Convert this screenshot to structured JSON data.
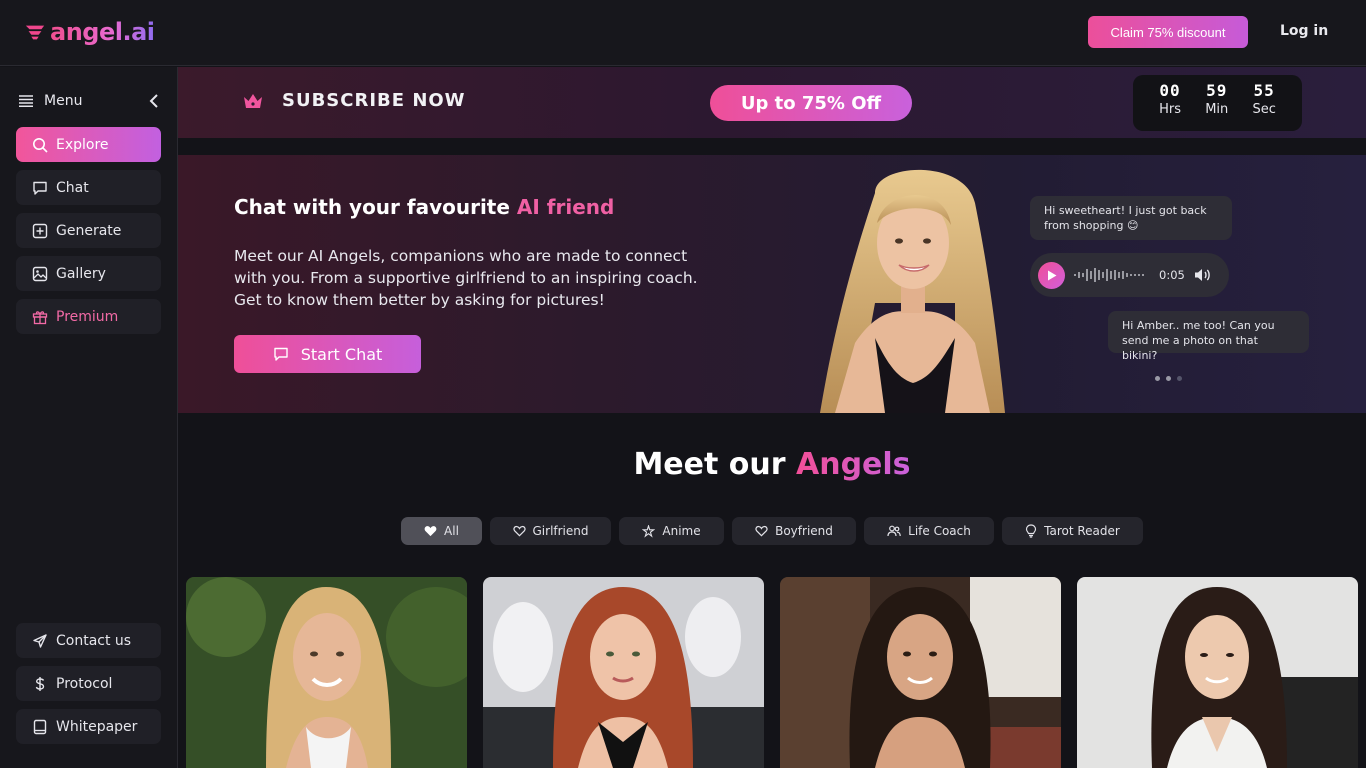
{
  "app": {
    "logo_text": "angel.ai"
  },
  "topbar": {
    "claim_label": "Claim 75% discount",
    "login_label": "Log in"
  },
  "sidebar": {
    "menu_label": "Menu",
    "items": [
      {
        "label": "Explore",
        "icon": "search-icon"
      },
      {
        "label": "Chat",
        "icon": "chat-icon"
      },
      {
        "label": "Generate",
        "icon": "plus-square-icon"
      },
      {
        "label": "Gallery",
        "icon": "image-icon"
      },
      {
        "label": "Premium",
        "icon": "gift-icon"
      }
    ],
    "bottom_items": [
      {
        "label": "Contact us",
        "icon": "send-icon"
      },
      {
        "label": "Protocol",
        "icon": "dollar-icon"
      },
      {
        "label": "Whitepaper",
        "icon": "book-icon"
      }
    ]
  },
  "subscribe": {
    "title": "SUBSCRIBE NOW",
    "offer_label": "Up to 75% Off",
    "timer": {
      "hrs": "00",
      "min": "59",
      "sec": "55",
      "hrs_label": "Hrs",
      "min_label": "Min",
      "sec_label": "Sec"
    }
  },
  "hero": {
    "title_prefix": "Chat with your favourite ",
    "title_accent": "AI friend",
    "description": "Meet our AI Angels, companions who are made to connect with you. From a supportive girlfriend to an inspiring coach. Get to know them better by asking for pictures!",
    "start_label": "Start Chat",
    "bubble_1": "Hi sweetheart! I just got back from shopping 😊",
    "audio_time": "0:05",
    "bubble_2": "Hi Amber.. me too! Can you send me a photo on that bikini?"
  },
  "meet": {
    "title_prefix": "Meet our ",
    "title_accent": "Angels",
    "filters": [
      {
        "label": "All",
        "icon": "heart-filled-icon",
        "active": true
      },
      {
        "label": "Girlfriend",
        "icon": "heart-icon"
      },
      {
        "label": "Anime",
        "icon": "anime-icon"
      },
      {
        "label": "Boyfriend",
        "icon": "heart-icon"
      },
      {
        "label": "Life Coach",
        "icon": "users-icon"
      },
      {
        "label": "Tarot Reader",
        "icon": "bulb-icon"
      }
    ]
  },
  "colors": {
    "accent_pink": "#ef4f98",
    "accent_purple": "#c65fdb",
    "background": "#131318"
  }
}
